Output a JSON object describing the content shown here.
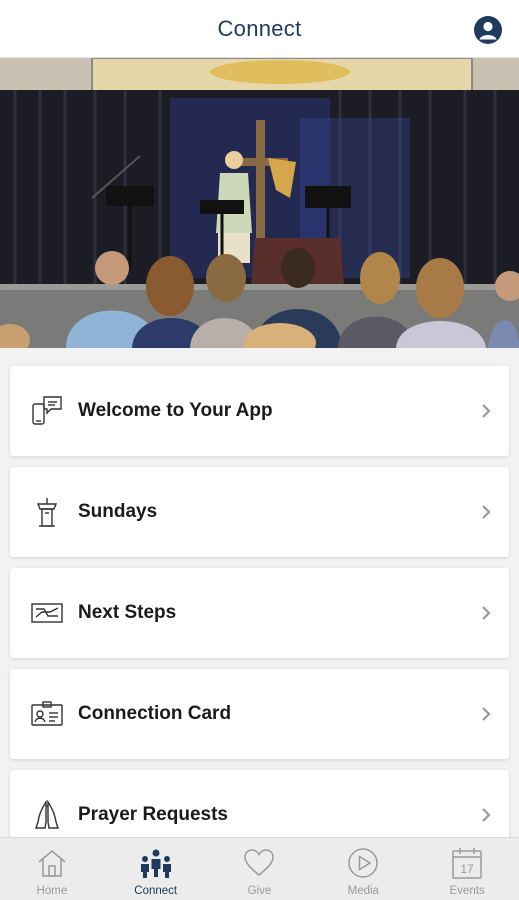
{
  "header": {
    "title": "Connect",
    "profile_icon": "user-profile-icon"
  },
  "colors": {
    "brand": "#1e3a5c",
    "tab_inactive": "#9a9a9a",
    "background": "#f2f2f2"
  },
  "menu": {
    "items": [
      {
        "label": "Welcome to Your App",
        "icon": "chat-phone-icon"
      },
      {
        "label": "Sundays",
        "icon": "podium-icon"
      },
      {
        "label": "Next Steps",
        "icon": "steps-icon"
      },
      {
        "label": "Connection Card",
        "icon": "id-card-icon"
      },
      {
        "label": "Prayer Requests",
        "icon": "praying-hands-icon"
      }
    ]
  },
  "tabbar": {
    "tabs": [
      {
        "label": "Home",
        "icon": "home-icon",
        "active": false
      },
      {
        "label": "Connect",
        "icon": "people-icon",
        "active": true
      },
      {
        "label": "Give",
        "icon": "heart-icon",
        "active": false
      },
      {
        "label": "Media",
        "icon": "play-icon",
        "active": false
      },
      {
        "label": "Events",
        "icon": "calendar-icon",
        "active": false
      }
    ],
    "calendar_day": "17"
  }
}
